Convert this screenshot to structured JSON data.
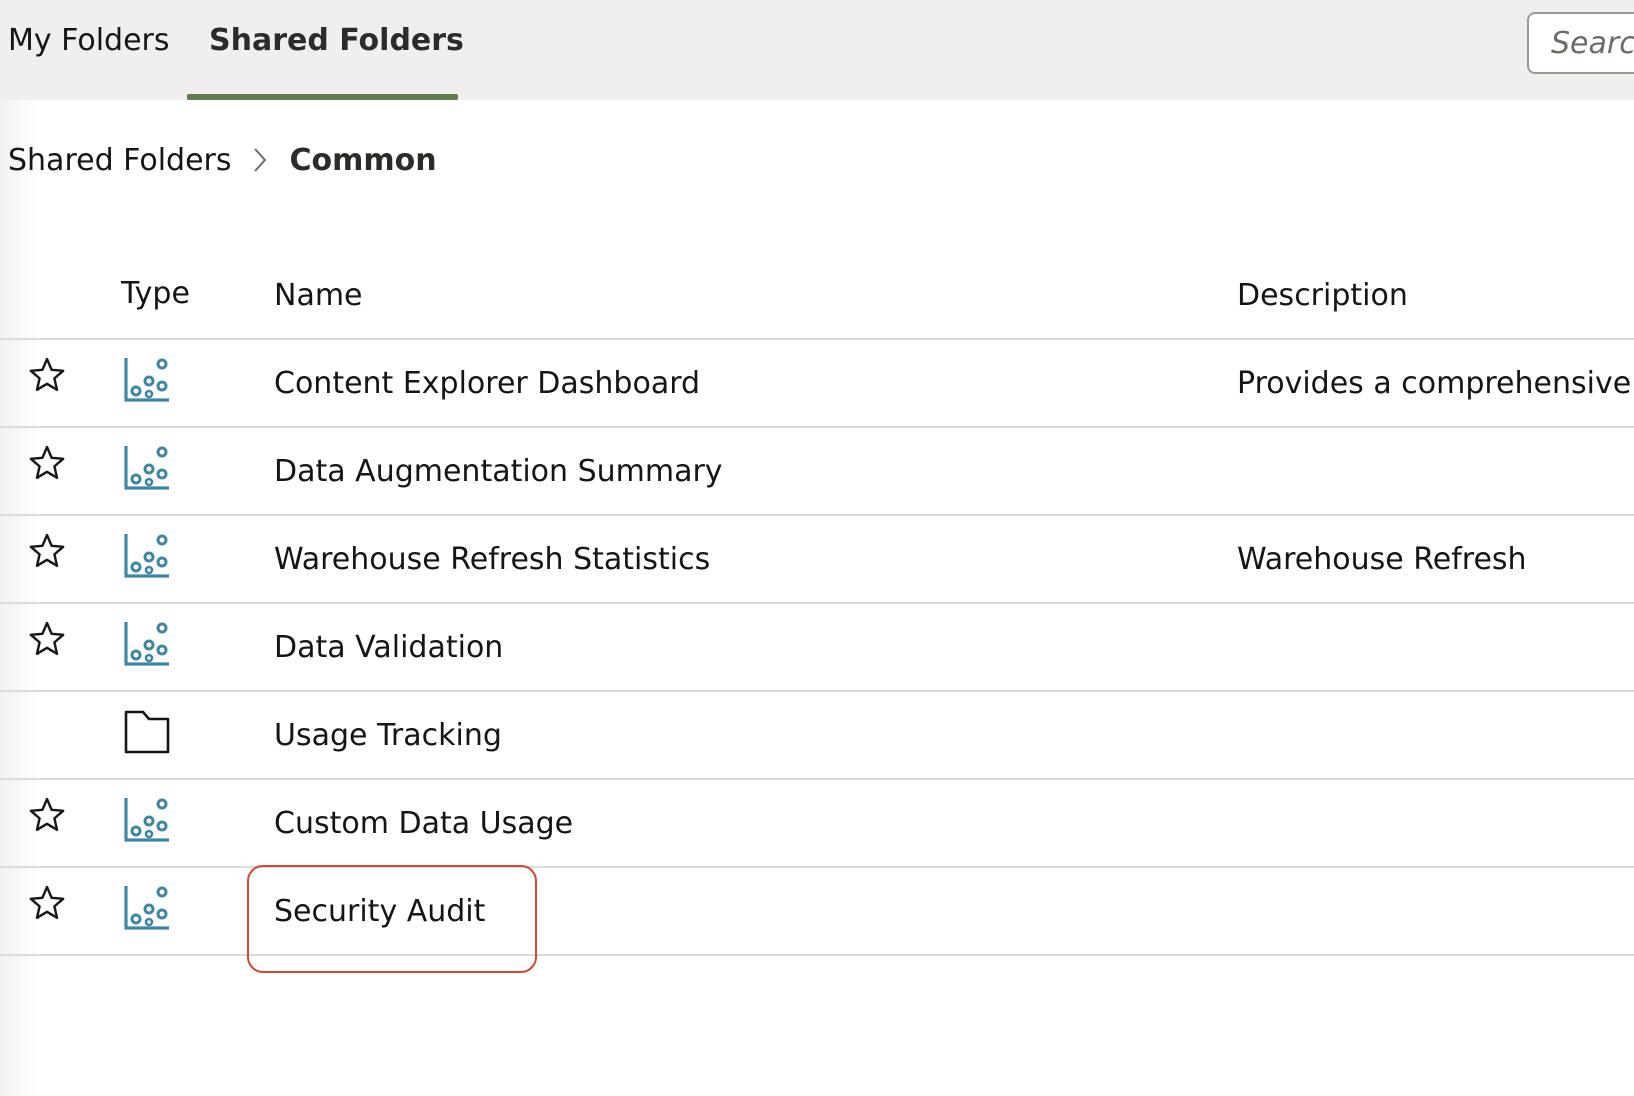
{
  "tabs": [
    {
      "label": "My Folders",
      "active": false
    },
    {
      "label": "Shared Folders",
      "active": true
    }
  ],
  "search": {
    "placeholder": "Search"
  },
  "breadcrumb": {
    "root": "Shared Folders",
    "current": "Common"
  },
  "columns": {
    "type": "Type",
    "name": "Name",
    "description": "Description"
  },
  "rows": [
    {
      "icon": "workbook-icon",
      "favorite": true,
      "name": "Content Explorer Dashboard",
      "description": "Provides a comprehensive view"
    },
    {
      "icon": "workbook-icon",
      "favorite": true,
      "name": "Data Augmentation Summary",
      "description": ""
    },
    {
      "icon": "workbook-icon",
      "favorite": true,
      "name": "Warehouse Refresh Statistics",
      "description": "Warehouse Refresh"
    },
    {
      "icon": "workbook-icon",
      "favorite": true,
      "name": "Data Validation",
      "description": ""
    },
    {
      "icon": "folder-icon",
      "favorite": false,
      "name": "Usage Tracking",
      "description": ""
    },
    {
      "icon": "workbook-icon",
      "favorite": true,
      "name": "Custom Data Usage",
      "description": ""
    },
    {
      "icon": "workbook-icon",
      "favorite": true,
      "name": "Security Audit",
      "description": ""
    }
  ],
  "highlighted_row": "Security Audit",
  "colors": {
    "active_tab_underline": "#5f7d4f",
    "workbook_icon": "#3f86a6",
    "highlight_box": "#d9462f"
  }
}
